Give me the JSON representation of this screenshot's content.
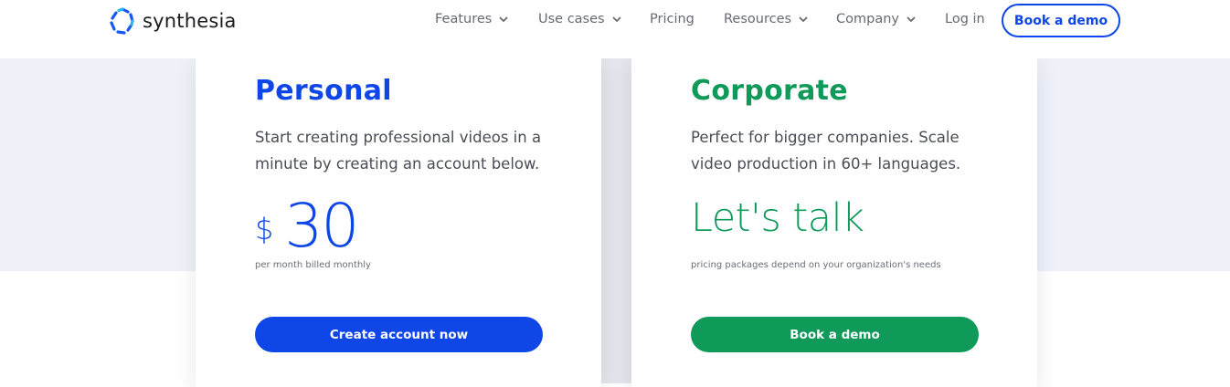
{
  "colors": {
    "brand_blue": "#0f46e8",
    "brand_green": "#0f9a5a",
    "band_bg": "#eef1f8"
  },
  "header": {
    "logo_text": "synthesia",
    "logo_icon": "synthesia-logo-icon",
    "nav": {
      "features": "Features",
      "use_cases": "Use cases",
      "pricing": "Pricing",
      "resources": "Resources",
      "company": "Company",
      "login": "Log in"
    },
    "book_demo": "Book a demo"
  },
  "plans": {
    "personal": {
      "title": "Personal",
      "description": "Start creating professional videos in a minute by creating an account below.",
      "currency": "$",
      "price": "30",
      "price_note": "per month billed monthly",
      "cta": "Create account now"
    },
    "corporate": {
      "title": "Corporate",
      "description": "Perfect for bigger companies. Scale video production in 60+ languages.",
      "price_text": "Let's talk",
      "price_note": "pricing packages depend on your organization's needs",
      "cta": "Book a demo"
    }
  }
}
